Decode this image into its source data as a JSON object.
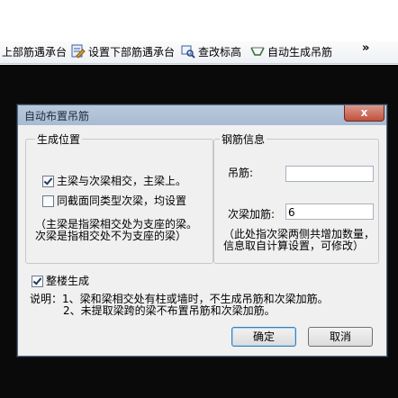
{
  "toolbar": {
    "items": [
      {
        "label": "上部筋遇承台"
      },
      {
        "label": "设置下部筋遇承台"
      },
      {
        "label": "查改标高"
      },
      {
        "label": "自动生成吊筋"
      }
    ],
    "overflow": "»"
  },
  "dialog": {
    "title": "自动布置吊筋",
    "close": "x",
    "position_group": {
      "title": "生成位置",
      "options": [
        {
          "label": "主梁与次梁相交，主梁上。",
          "checked": true
        },
        {
          "label": "同截面同类型次梁，均设置",
          "checked": false
        }
      ],
      "note_line1": "（主梁是指梁相交处为支座的梁。",
      "note_line2": "次梁是指相交处不为支座的梁）"
    },
    "rebar_group": {
      "title": "钢筋信息",
      "hanger_label": "吊筋:",
      "hanger_value": "",
      "extra_label": "次梁加筋:",
      "extra_value": "6",
      "note_line1": "（此处指次梁两侧共增加数量，",
      "note_line2": "信息取自计算设置，可修改）"
    },
    "whole_floor": {
      "label": "整楼生成",
      "checked": true
    },
    "explain_line1": "说明：1、梁和梁相交处有柱或墙时，不生成吊筋和次梁加筋。",
    "explain_line2": "2、未提取梁跨的梁不布置吊筋和次梁加筋。",
    "ok_label": "确定",
    "cancel_label": "取消"
  }
}
